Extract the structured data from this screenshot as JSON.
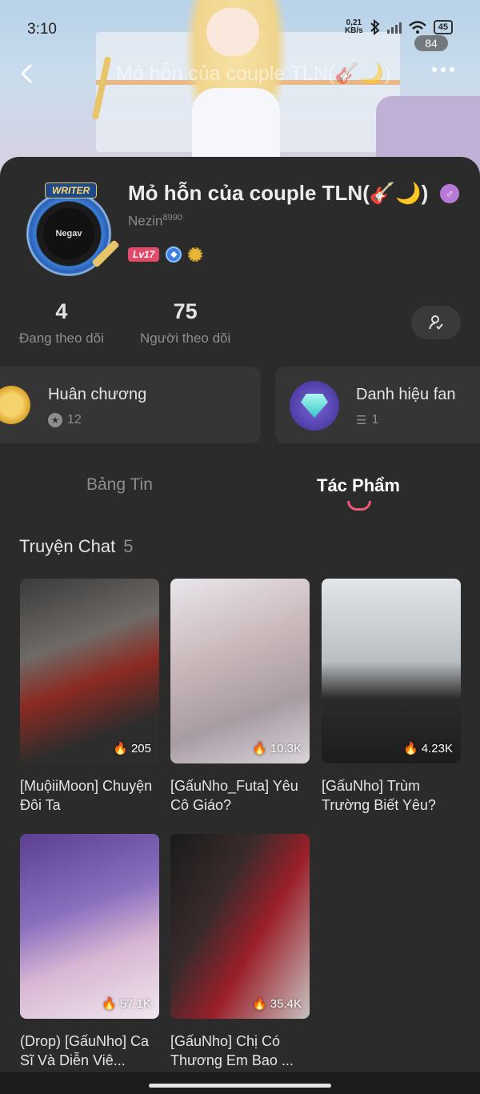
{
  "status_bar": {
    "time": "3:10",
    "network_speed": "0,21",
    "network_unit": "KB/s",
    "battery": "45"
  },
  "header": {
    "title": "Mỏ hỗn của couple TLN(🎸🌙)",
    "like_count": "84"
  },
  "profile": {
    "avatar_tag": "WRITER",
    "avatar_text": "Negav",
    "name": "Mỏ hỗn của couple TLN(🎸🌙)",
    "username": "Nezin",
    "username_suffix": "8990",
    "level": "Lv17"
  },
  "stats": {
    "following": {
      "value": "4",
      "label": "Đang theo dõi"
    },
    "followers": {
      "value": "75",
      "label": "Người theo dõi"
    }
  },
  "info_cards": {
    "medals": {
      "title": "Huân chương",
      "count": "12"
    },
    "fan_titles": {
      "title": "Danh hiệu fan",
      "count": "1"
    }
  },
  "tabs": {
    "news": "Bảng Tin",
    "works": "Tác Phẩm",
    "active": "works"
  },
  "section": {
    "title": "Truyện Chat",
    "count": "5"
  },
  "works": [
    {
      "title": "[MuộiiMoon] Chuyện Đôi Ta",
      "views": "205"
    },
    {
      "title": "[GấuNho_Futa] Yêu Cô Giáo?",
      "views": "10.3K"
    },
    {
      "title": "[GấuNho] Trùm Trường Biết Yêu?",
      "views": "4.23K"
    },
    {
      "title": "(Drop) [GấuNho] Ca Sĩ Và Diễn Viê...",
      "views": "57.1K"
    },
    {
      "title": "[GấuNho] Chị Có Thương Em Bao ...",
      "views": "35.4K"
    }
  ],
  "colors": {
    "background": "#2b2b2b",
    "card": "#353535",
    "accent_pink": "#f05a78",
    "level_badge": "#e24a6a"
  }
}
